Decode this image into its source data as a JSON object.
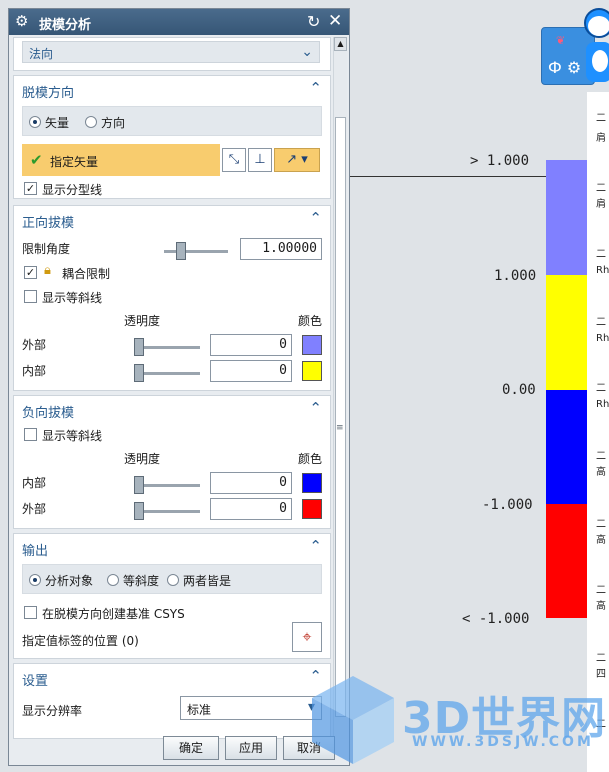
{
  "dialog": {
    "title": "拔模分析",
    "top_select": {
      "value": "法向"
    },
    "direction": {
      "header": "脱模方向",
      "radio_vector": "矢量",
      "radio_direction": "方向",
      "specify_vector": "指定矢量",
      "show_parting_line": "显示分型线"
    },
    "positive": {
      "header": "正向拔模",
      "limit_angle_label": "限制角度",
      "limit_angle_value": "1.00000",
      "coupled_limit": "耦合限制",
      "show_isoclines": "显示等斜线",
      "transparency_label": "透明度",
      "color_label": "颜色",
      "outer_label": "外部",
      "outer_value": "0",
      "outer_color": "#8080ff",
      "inner_label": "内部",
      "inner_value": "0",
      "inner_color": "#ffff00"
    },
    "negative": {
      "header": "负向拔模",
      "show_isoclines": "显示等斜线",
      "transparency_label": "透明度",
      "color_label": "颜色",
      "inner_label": "内部",
      "inner_value": "0",
      "inner_color": "#0000ff",
      "outer_label": "外部",
      "outer_value": "0",
      "outer_color": "#ff0000"
    },
    "output": {
      "header": "输出",
      "radio_analysis_object": "分析对象",
      "radio_isocline": "等斜度",
      "radio_both": "两者皆是",
      "create_csys": "在脱模方向创建基准 CSYS",
      "label_position": "指定值标签的位置 (0)"
    },
    "settings": {
      "header": "设置",
      "resolution_label": "显示分辨率",
      "resolution_value": "标准"
    },
    "buttons": {
      "ok": "确定",
      "apply": "应用",
      "cancel": "取消"
    }
  },
  "legend": {
    "labels": [
      "> 1.000",
      "1.000",
      "0.00",
      "-1.000",
      "< -1.000"
    ],
    "colors": [
      "#8080ff",
      "#ffff00",
      "#0000ff",
      "#ff0000"
    ]
  },
  "right_list": {
    "items": [
      "二",
      "肩",
      "二",
      "肩",
      "二",
      "Rh",
      "二",
      "Rh",
      "二",
      "Rh",
      "二",
      "高",
      "二",
      "高",
      "二",
      "高",
      "二",
      "四",
      "二"
    ]
  },
  "watermark": {
    "brand": "3D世界网",
    "url": "WWW.3DSJW.COM"
  }
}
